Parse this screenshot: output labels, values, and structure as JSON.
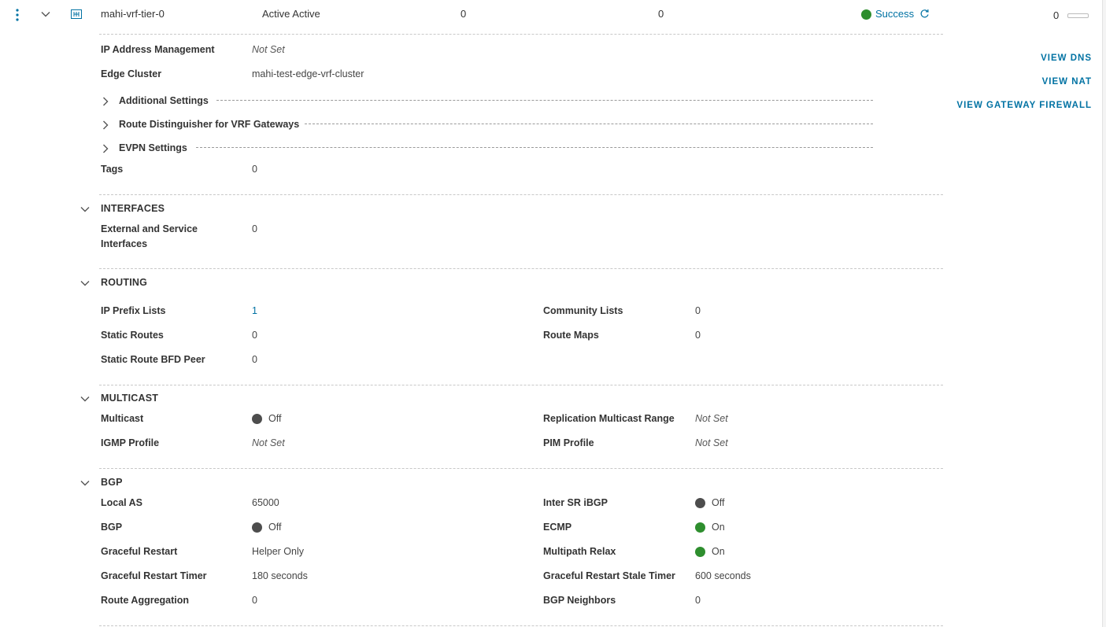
{
  "row": {
    "name": "mahi-vrf-tier-0",
    "ha_mode": "Active Active",
    "col3": "0",
    "col4": "0",
    "status": "Success",
    "alarms": "0"
  },
  "details": {
    "ipam_label": "IP Address Management",
    "ipam_value": "Not Set",
    "edge_cluster_label": "Edge Cluster",
    "edge_cluster_value": "mahi-test-edge-vrf-cluster",
    "additional_settings": "Additional Settings",
    "route_distinguisher": "Route Distinguisher for VRF Gateways",
    "evpn_settings": "EVPN Settings",
    "tags_label": "Tags",
    "tags_value": "0"
  },
  "actions": {
    "view_dns": "VIEW DNS",
    "view_nat": "VIEW NAT",
    "view_firewall": "VIEW GATEWAY FIREWALL"
  },
  "interfaces": {
    "title": "INTERFACES",
    "ext_label_line1": "External and Service",
    "ext_label_line2": "Interfaces",
    "ext_value": "0"
  },
  "routing": {
    "title": "ROUTING",
    "ip_prefix_label": "IP Prefix Lists",
    "ip_prefix_value": "1",
    "community_label": "Community Lists",
    "community_value": "0",
    "static_routes_label": "Static Routes",
    "static_routes_value": "0",
    "route_maps_label": "Route Maps",
    "route_maps_value": "0",
    "bfd_label": "Static Route BFD Peer",
    "bfd_value": "0"
  },
  "multicast": {
    "title": "MULTICAST",
    "multicast_label": "Multicast",
    "multicast_value": "Off",
    "replication_label": "Replication Multicast Range",
    "replication_value": "Not Set",
    "igmp_label": "IGMP Profile",
    "igmp_value": "Not Set",
    "pim_label": "PIM Profile",
    "pim_value": "Not Set"
  },
  "bgp": {
    "title": "BGP",
    "local_as_label": "Local AS",
    "local_as_value": "65000",
    "inter_sr_label": "Inter SR iBGP",
    "inter_sr_value": "Off",
    "bgp_label": "BGP",
    "bgp_value": "Off",
    "ecmp_label": "ECMP",
    "ecmp_value": "On",
    "gr_label": "Graceful Restart",
    "gr_value": "Helper Only",
    "multipath_label": "Multipath Relax",
    "multipath_value": "On",
    "gr_timer_label": "Graceful Restart Timer",
    "gr_timer_value": "180 seconds",
    "gr_stale_label": "Graceful Restart Stale Timer",
    "gr_stale_value": "600 seconds",
    "route_agg_label": "Route Aggregation",
    "route_agg_value": "0",
    "neighbors_label": "BGP Neighbors",
    "neighbors_value": "0"
  },
  "colors": {
    "link": "#0072a3",
    "success": "#2e8e2e",
    "off": "#4d4d4d"
  }
}
